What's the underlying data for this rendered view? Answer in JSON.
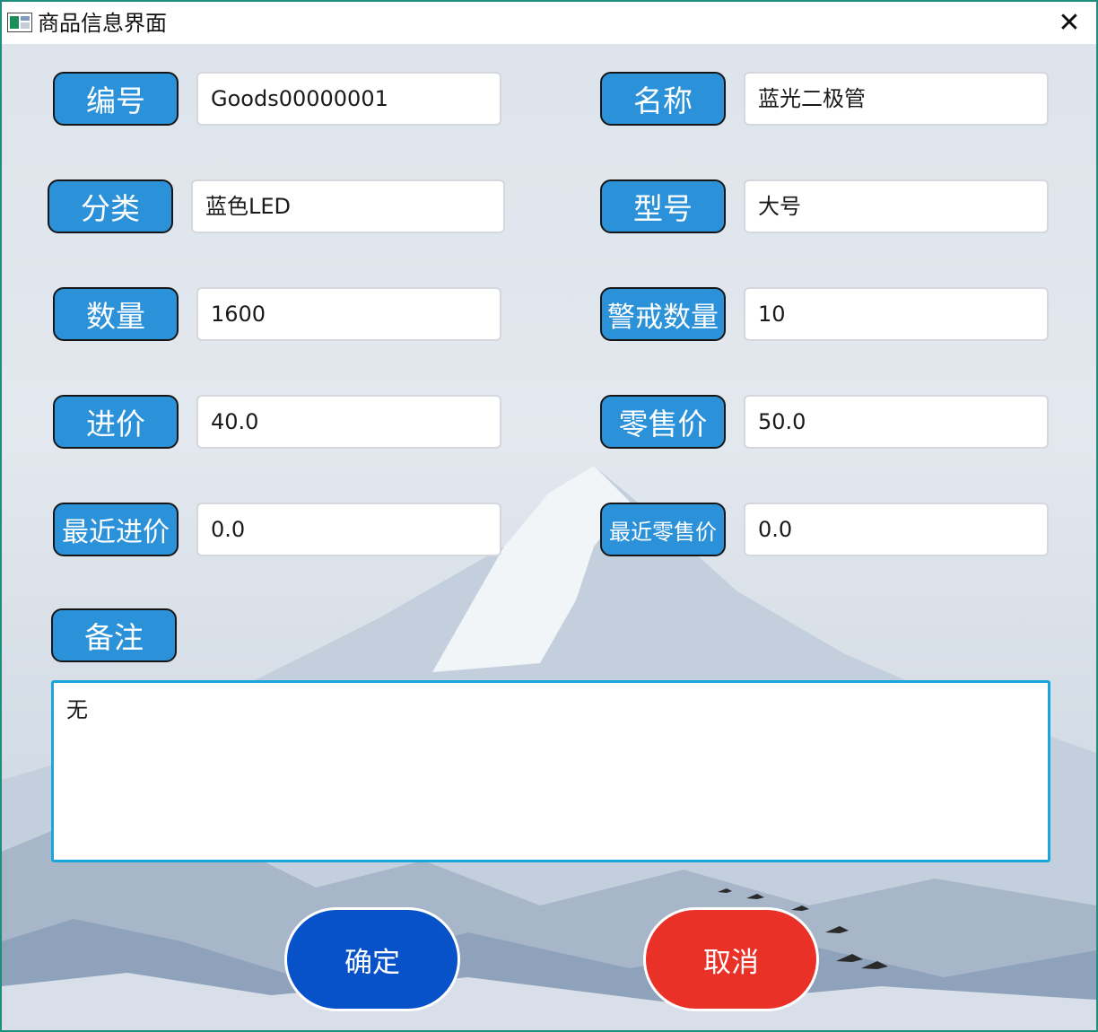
{
  "window": {
    "title": "商品信息界面",
    "close_glyph": "✕",
    "icon": "app-window-icon"
  },
  "form": {
    "rows": [
      {
        "left_label": "编号",
        "left_value": "Goods00000001",
        "right_label": "名称",
        "right_value": "蓝光二极管"
      },
      {
        "left_label": "分类",
        "left_value": "蓝色LED",
        "right_label": "型号",
        "right_value": "大号"
      },
      {
        "left_label": "数量",
        "left_value": "1600",
        "right_label": "警戒数量",
        "right_value": "10"
      },
      {
        "left_label": "进价",
        "left_value": "40.0",
        "right_label": "零售价",
        "right_value": "50.0"
      },
      {
        "left_label": "最近进价",
        "left_value": "0.0",
        "right_label": "最近零售价",
        "right_value": "0.0"
      }
    ],
    "notes_label": "备注",
    "notes_value": "无"
  },
  "actions": {
    "confirm": "确定",
    "cancel": "取消"
  },
  "colors": {
    "label_bg": "#2b91d9",
    "confirm_bg": "#0752c8",
    "cancel_bg": "#ea3127",
    "window_border": "#1f8e7c",
    "notes_border": "#1aa5db"
  }
}
